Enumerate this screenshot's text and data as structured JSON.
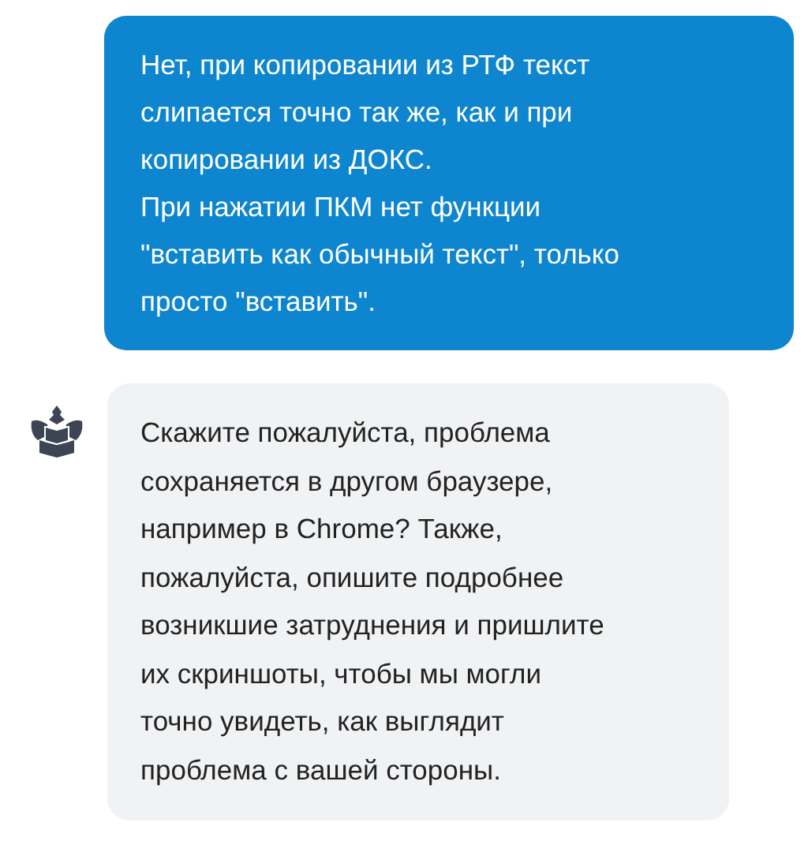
{
  "messages": [
    {
      "kind": "sent",
      "paragraphs": [
        "Нет, при копировании из РТФ текст\nслипается точно так же, как и при\nкопировании из ДОКС.",
        "При нажатии ПКМ нет функции\n\"вставить как обычный текст\", только\nпросто \"вставить\"."
      ]
    },
    {
      "kind": "received",
      "paragraphs": [
        "Скажите пожалуйста, проблема\nсохраняется в другом браузере,\nнапример в Chrome? Также,\nпожалуйста, опишите подробнее\nвозникшие затруднения и пришлите\nих скриншоты, чтобы мы могли\nточно увидеть, как выглядит\nпроблема с вашей стороны."
      ]
    }
  ]
}
